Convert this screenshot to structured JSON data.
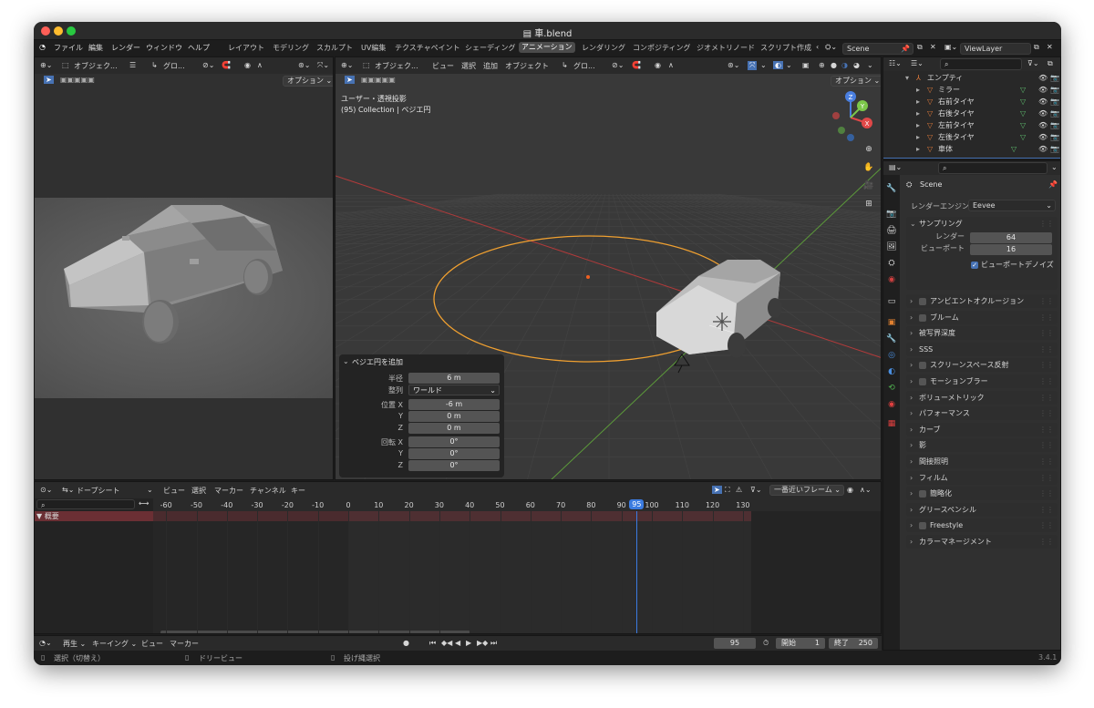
{
  "window": {
    "title": "車.blend"
  },
  "menu": [
    "ファイル",
    "編集",
    "レンダー",
    "ウィンドウ",
    "ヘルプ"
  ],
  "workspaces": [
    "レイアウト",
    "モデリング",
    "スカルプト",
    "UV編集",
    "テクスチャペイント",
    "シェーディング",
    "アニメーション",
    "レンダリング",
    "コンポジティング",
    "ジオメトリノード",
    "スクリプト作成"
  ],
  "active_workspace": "アニメーション",
  "scene": {
    "name": "Scene",
    "view_layer": "ViewLayer"
  },
  "camera_view": {
    "mode_label": "オブジェク...",
    "orientation": "グロ...",
    "options": "オプション ⌄"
  },
  "viewport": {
    "mode_label": "オブジェク...",
    "menus": [
      "ビュー",
      "選択",
      "追加",
      "オブジェクト"
    ],
    "orientation": "グロ...",
    "options": "オプション ⌄",
    "info_line1": "ユーザー・透視投影",
    "info_line2": "(95) Collection | ベジエ円",
    "gizmo_axes": {
      "x": "X",
      "y": "Y",
      "z": "Z"
    }
  },
  "operator_panel": {
    "title": "ベジエ円を追加",
    "radius_label": "半径",
    "radius_value": "6 m",
    "align_label": "整列",
    "align_value": "ワールド",
    "location_label": "位置 X",
    "loc_y_label": "Y",
    "loc_z_label": "Z",
    "loc_x": "-6 m",
    "loc_y": "0 m",
    "loc_z": "0 m",
    "rotation_label": "回転 X",
    "rot_y_label": "Y",
    "rot_z_label": "Z",
    "rot_x": "0°",
    "rot_y": "0°",
    "rot_z": "0°"
  },
  "dopesheet": {
    "mode": "ドープシート",
    "menus": [
      "ビュー",
      "選択",
      "マーカー",
      "チャンネル",
      "キー"
    ],
    "snap": "一番近いフレーム",
    "summary": "▼ 概要",
    "ruler": [
      "-60",
      "-50",
      "-40",
      "-30",
      "-20",
      "-10",
      "0",
      "10",
      "20",
      "30",
      "40",
      "50",
      "60",
      "70",
      "80",
      "90",
      "95",
      "100",
      "110",
      "120",
      "130"
    ],
    "current_frame": 95
  },
  "timeline": {
    "menus": [
      "再生 ⌄",
      "キーイング ⌄",
      "ビュー",
      "マーカー"
    ],
    "frame": "95",
    "start_label": "開始",
    "start": "1",
    "end_label": "終了",
    "end": "250"
  },
  "statusbar": {
    "left": "選択（切替え）",
    "mid": "ドリービュー",
    "right": "投げ縄選択",
    "version": "3.4.1"
  },
  "outliner": {
    "items": [
      {
        "name": "エンプティ",
        "icon_color": "#e07a3a"
      },
      {
        "name": "ミラー",
        "icon_color": "#e07a3a"
      },
      {
        "name": "右前タイヤ",
        "icon_color": "#e07a3a"
      },
      {
        "name": "右後タイヤ",
        "icon_color": "#e07a3a"
      },
      {
        "name": "左前タイヤ",
        "icon_color": "#e07a3a"
      },
      {
        "name": "左後タイヤ",
        "icon_color": "#e07a3a"
      },
      {
        "name": "車体",
        "icon_color": "#e07a3a"
      }
    ]
  },
  "properties": {
    "scene_name": "Scene",
    "render_engine_label": "レンダーエンジン",
    "render_engine": "Eevee",
    "sampling_title": "サンプリング",
    "render_label": "レンダー",
    "render_samples": "64",
    "viewport_label": "ビューポート",
    "viewport_samples": "16",
    "viewport_denoise": "ビューポートデノイズ",
    "panels": [
      {
        "label": "アンビエントオクルージョン",
        "checkbox": true
      },
      {
        "label": "ブルーム",
        "checkbox": true
      },
      {
        "label": "被写界深度",
        "checkbox": false
      },
      {
        "label": "SSS",
        "checkbox": false
      },
      {
        "label": "スクリーンスペース反射",
        "checkbox": true
      },
      {
        "label": "モーションブラー",
        "checkbox": true
      },
      {
        "label": "ボリューメトリック",
        "checkbox": false
      },
      {
        "label": "パフォーマンス",
        "checkbox": false
      },
      {
        "label": "カーブ",
        "checkbox": false
      },
      {
        "label": "影",
        "checkbox": false
      },
      {
        "label": "間接照明",
        "checkbox": false
      },
      {
        "label": "フィルム",
        "checkbox": false
      },
      {
        "label": "簡略化",
        "checkbox": true
      },
      {
        "label": "グリースペンシル",
        "checkbox": false
      },
      {
        "label": "Freestyle",
        "checkbox": true
      },
      {
        "label": "カラーマネージメント",
        "checkbox": false
      }
    ]
  },
  "colors": {
    "accent": "#4772b3",
    "curve": "#f0a030",
    "playhead": "#3b7be0"
  }
}
